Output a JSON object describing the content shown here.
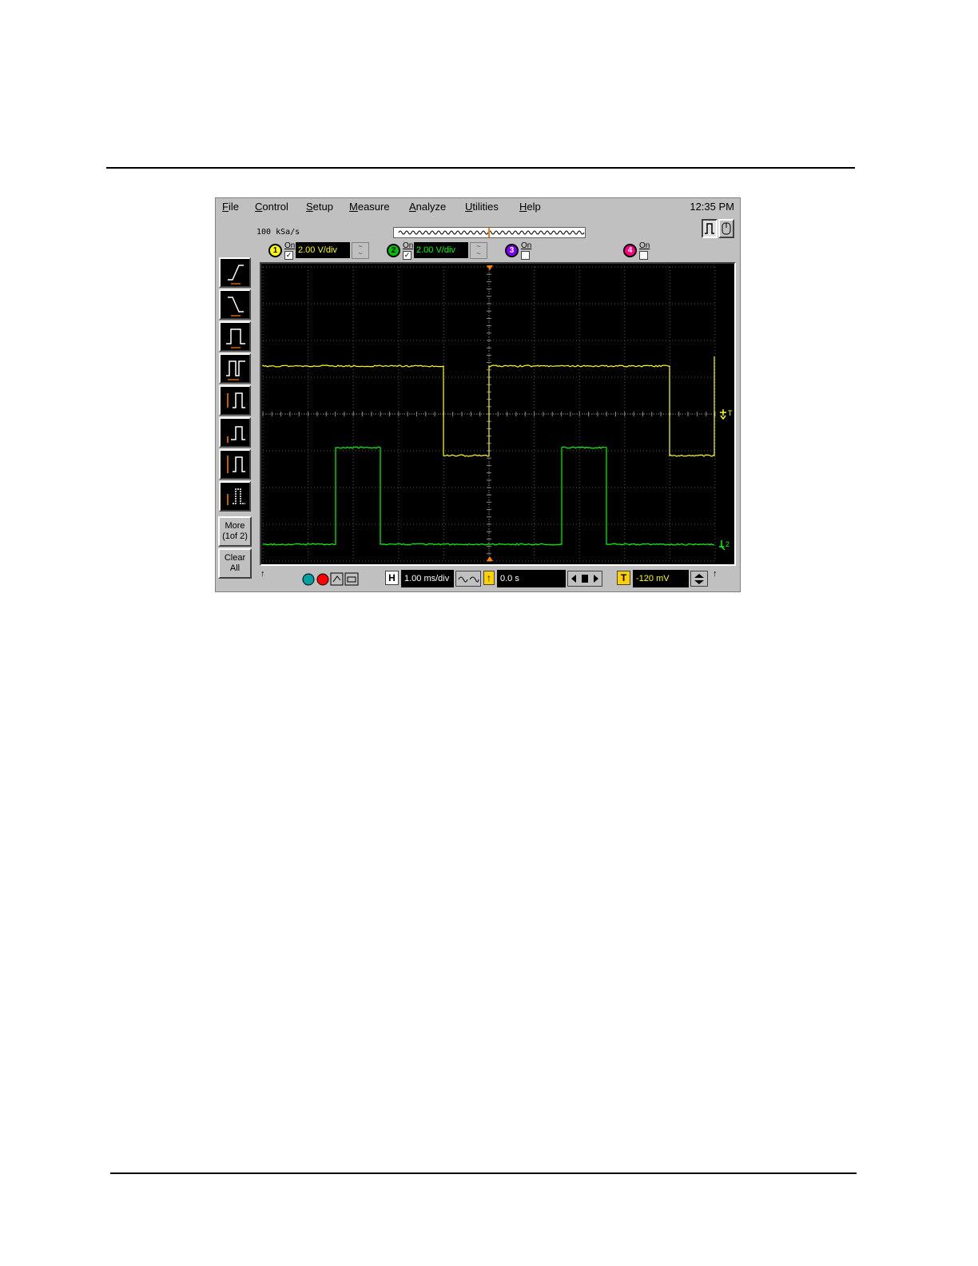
{
  "menu": {
    "items": [
      {
        "label": "File"
      },
      {
        "label": "Control"
      },
      {
        "label": "Setup"
      },
      {
        "label": "Measure"
      },
      {
        "label": "Analyze"
      },
      {
        "label": "Utilities"
      },
      {
        "label": "Help"
      }
    ],
    "clock": "12:35 PM"
  },
  "acquisition": {
    "sample_rate": "100 kSa/s"
  },
  "channels": [
    {
      "number": "1",
      "on_label": "On",
      "enabled": true,
      "scale": "2.00 V/div",
      "color": "#ffff00"
    },
    {
      "number": "2",
      "on_label": "On",
      "enabled": true,
      "scale": "2.00 V/div",
      "color": "#00ff00"
    },
    {
      "number": "3",
      "on_label": "On",
      "enabled": false,
      "scale": "",
      "color": "#8000ff"
    },
    {
      "number": "4",
      "on_label": "On",
      "enabled": false,
      "scale": "",
      "color": "#ff0080"
    }
  ],
  "left_toolbar": {
    "icons": [
      "rise-time-icon",
      "fall-time-icon",
      "pulse-width-icon",
      "period-icon",
      "vpp-icon",
      "vmin-icon",
      "vmax-icon",
      "vavg-icon"
    ],
    "more_label_1": "More",
    "more_label_2": "(1of 2)",
    "clear_label_1": "Clear",
    "clear_label_2": "All"
  },
  "timebase": {
    "h_label": "H",
    "scale": "1.00 ms/div",
    "position": "0.0 s"
  },
  "trigger": {
    "t_label": "T",
    "level": "-120 mV",
    "marker_label": "T",
    "ch2_marker": "2"
  },
  "colors": {
    "ch1": "#ffff00",
    "ch2": "#00ff00",
    "grid": "#555555",
    "screen_bg": "#000000",
    "trigger_marker": "#ff8000"
  }
}
